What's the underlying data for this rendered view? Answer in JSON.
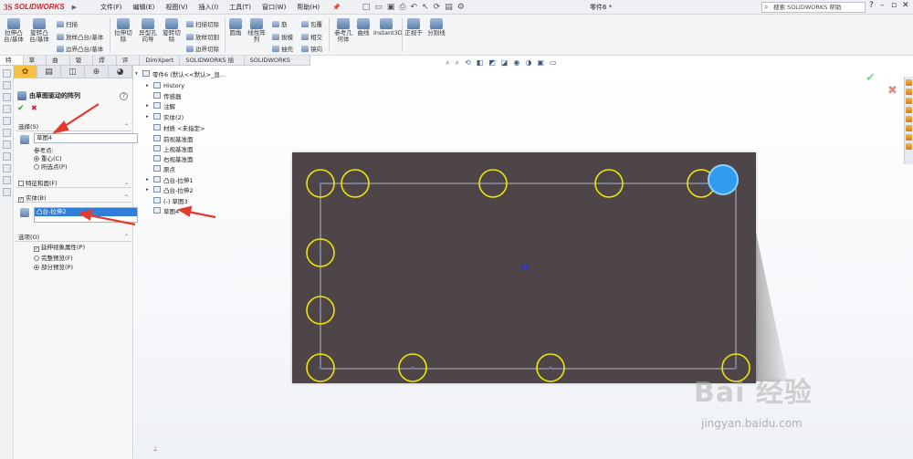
{
  "app": {
    "logo_prefix": "3S",
    "logo_name": "SOLIDWORKS",
    "menu": [
      "文件(F)",
      "编辑(E)",
      "视图(V)",
      "插入(I)",
      "工具(T)",
      "窗口(W)",
      "帮助(H)"
    ],
    "document_title": "零件6 *",
    "search_placeholder": "搜索 SOLIDWORKS 帮助"
  },
  "ribbon": {
    "extrude_boss": "拉伸凸\n台/基体",
    "revolve_boss": "旋转凸\n台/基体",
    "sweep": "扫描",
    "loft": "放样凸台/基体",
    "boundary": "边界凸台/基体",
    "extrude_cut": "拉伸切\n除",
    "hole_wizard": "异型孔\n向导",
    "revolve_cut": "旋转切\n除",
    "sweep_cut": "扫描切除",
    "loft_cut": "放样切割",
    "boundary_cut": "边界切除",
    "fillet": "圆角",
    "linear_pattern": "线性阵\n列",
    "rib": "筋",
    "draft": "拔模",
    "shell": "抽壳",
    "wrap": "包覆",
    "intersect": "相交",
    "mirror": "镜向",
    "ref_geometry": "参考几\n何体",
    "curves": "曲线",
    "instant3d": "Instant3D",
    "normal_to": "正视于",
    "split_line": "分割线"
  },
  "tabs": [
    "特征",
    "草图",
    "曲面",
    "钣金",
    "焊件",
    "评估",
    "DimXpert",
    "SOLIDWORKS 插件",
    "SOLIDWORKS MBD"
  ],
  "active_tab": "特征",
  "property_manager": {
    "title": "由草图驱动的阵列",
    "section_selection": "选择(S)",
    "reference_sketch": "草图4",
    "reference_point_label": "参考点:",
    "option_centroid": "重心(C)",
    "option_selected_point": "所选点(P)",
    "section_features_faces": "特征和面(F)",
    "section_bodies": "实体(B)",
    "selected_body": "凸台-拉伸2",
    "section_options": "选项(O)",
    "propagate_visual": "延伸视象属性(P)",
    "full_preview": "完整预览(F)",
    "partial_preview": "部分预览(P)"
  },
  "tree": {
    "root": "零件6 (默认<<默认>_显...",
    "items": [
      "History",
      "传感器",
      "注解",
      "实体(2)",
      "材质 <未指定>",
      "前视基准面",
      "上视基准面",
      "右视基准面",
      "原点",
      "凸台-拉伸1",
      "凸台-拉伸2",
      "(-) 草图3",
      "草图4"
    ]
  },
  "watermark": {
    "brand": "Bai  经验",
    "url": "jingyan.baidu.com"
  },
  "colors": {
    "plate": "#4d4547",
    "circle": "#f0e500",
    "highlight": "#3aa4ef",
    "arrow": "#e33a2e",
    "solidworks_red": "#d2232a"
  }
}
